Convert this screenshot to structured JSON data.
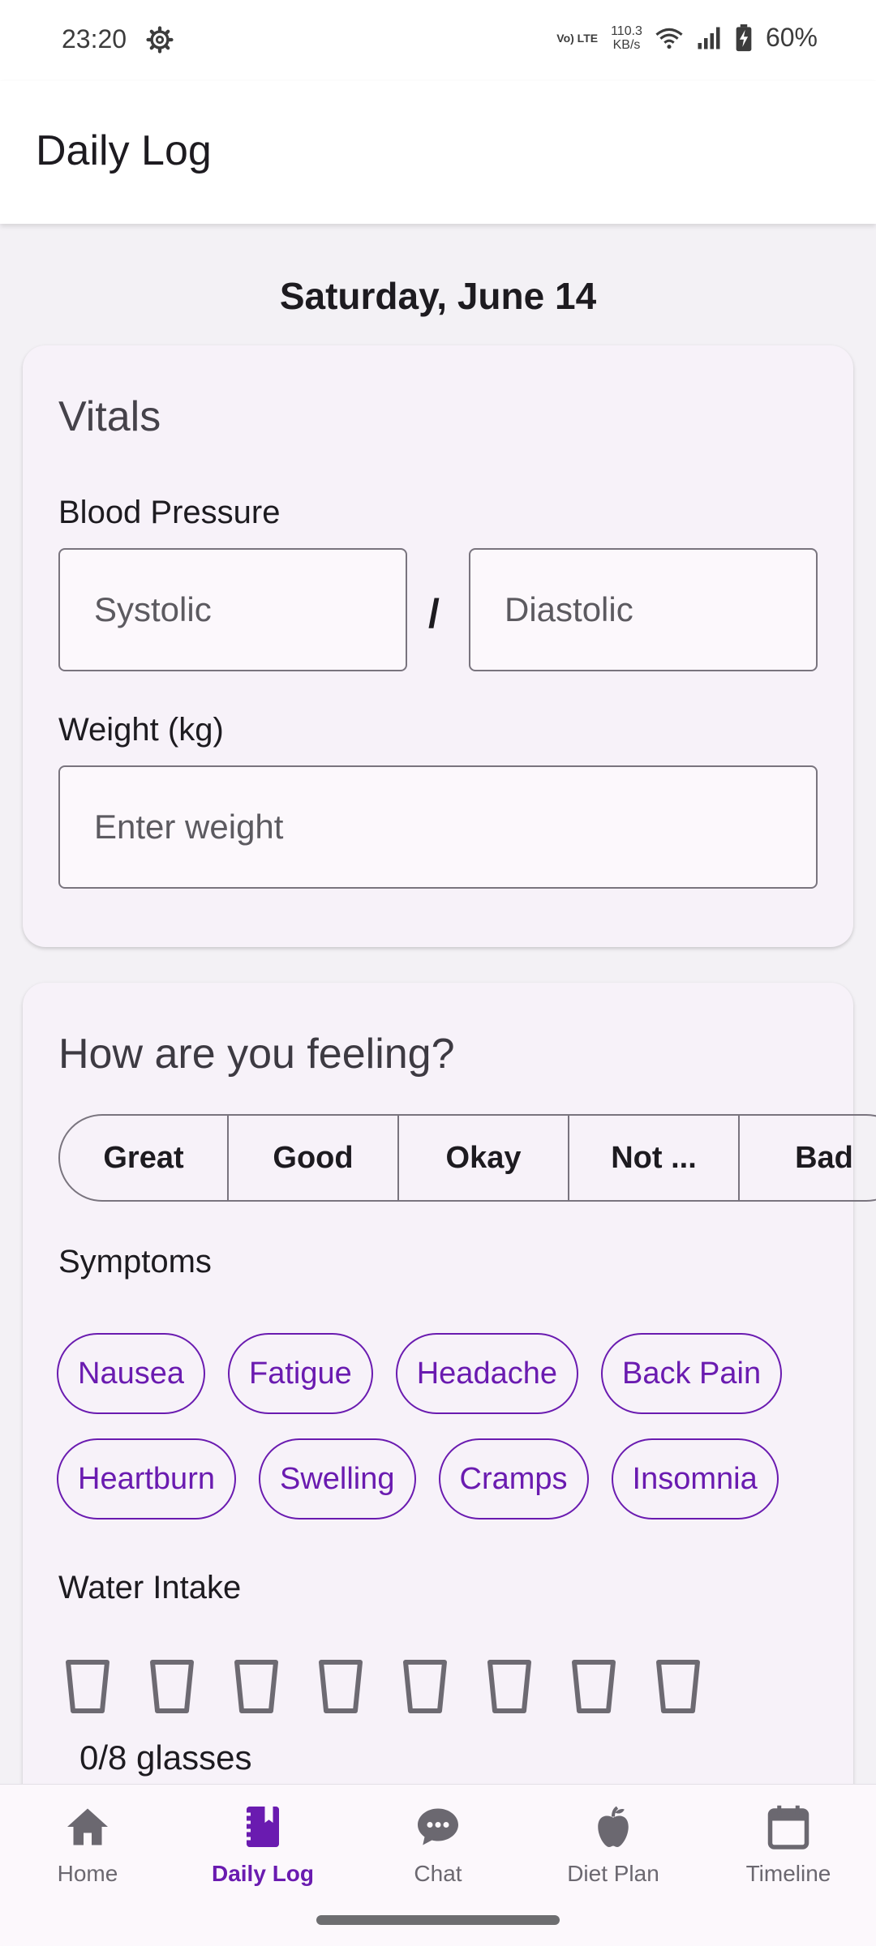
{
  "status_bar": {
    "time": "23:20",
    "network_tag": "Vo) LTE",
    "speed_value": "110.3",
    "speed_unit": "KB/s",
    "battery": "60%"
  },
  "app_bar": {
    "title": "Daily Log"
  },
  "date": "Saturday, June 14",
  "vitals": {
    "heading": "Vitals",
    "bp_label": "Blood Pressure",
    "systolic_placeholder": "Systolic",
    "separator": "/",
    "diastolic_placeholder": "Diastolic",
    "weight_label": "Weight (kg)",
    "weight_placeholder": "Enter weight"
  },
  "feeling": {
    "heading": "How are you feeling?",
    "options": [
      "Great",
      "Good",
      "Okay",
      "Not ...",
      "Bad"
    ],
    "symptoms_label": "Symptoms",
    "symptoms": [
      "Nausea",
      "Fatigue",
      "Headache",
      "Back Pain",
      "Heartburn",
      "Swelling",
      "Cramps",
      "Insomnia"
    ],
    "water_label": "Water Intake",
    "water_glasses_total": 8,
    "water_glasses_filled": 0,
    "water_count_text": "0/8 glasses"
  },
  "bottom_nav": {
    "items": [
      {
        "label": "Home",
        "icon": "home-icon"
      },
      {
        "label": "Daily Log",
        "icon": "journal-icon"
      },
      {
        "label": "Chat",
        "icon": "chat-icon"
      },
      {
        "label": "Diet Plan",
        "icon": "apple-icon"
      },
      {
        "label": "Timeline",
        "icon": "calendar-icon"
      }
    ],
    "active_index": 1
  },
  "colors": {
    "accent": "#6a1bb0",
    "outline": "#79747e",
    "card_bg": "#f7f2f9",
    "page_bg": "#f3f1f5"
  }
}
